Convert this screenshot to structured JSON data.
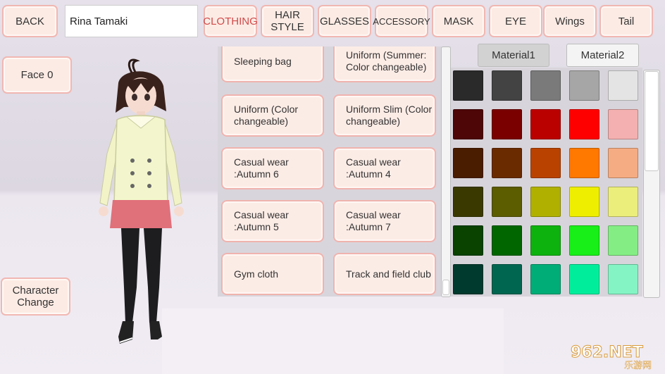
{
  "top": {
    "back_label": "BACK",
    "name_value": "Rina Tamaki",
    "tabs": [
      {
        "label": "CLOTHING",
        "active": true
      },
      {
        "label": "HAIR\nSTYLE"
      },
      {
        "label": "GLASSES"
      },
      {
        "label": "ACCESSORY"
      },
      {
        "label": "MASK"
      },
      {
        "label": "EYE"
      },
      {
        "label": "Wings"
      },
      {
        "label": "Tail"
      }
    ]
  },
  "left": {
    "face_label": "Face",
    "face_value": "0",
    "character_change_label": "Character\nChange"
  },
  "clothing_list": [
    "Sleeping bag",
    "Uniform (Summer:\nColor changeable)",
    "Uniform (Color\nchangeable)",
    "Uniform Slim (Color\nchangeable)",
    "Casual wear\n:Autumn 6",
    "Casual wear\n:Autumn 4",
    "Casual wear\n:Autumn 5",
    "Casual wear\n:Autumn 7",
    "Gym cloth",
    "Track and field club"
  ],
  "material_tabs": [
    "Material1",
    "Material2"
  ],
  "palette": [
    [
      "#2a2a2a",
      "#434343",
      "#7a7a7a",
      "#a6a6a6",
      "#e4e4e4"
    ],
    [
      "#4e0606",
      "#7a0000",
      "#bb0000",
      "#ff0000",
      "#f4b0b0"
    ],
    [
      "#4a1d00",
      "#6b2b00",
      "#ba4200",
      "#ff7800",
      "#f6ac82"
    ],
    [
      "#3a3a00",
      "#5c5c00",
      "#b0b000",
      "#eeee00",
      "#ecee7c"
    ],
    [
      "#0a4200",
      "#026600",
      "#0eb20e",
      "#18ee18",
      "#84ee84"
    ],
    [
      "#003a2e",
      "#006650",
      "#00ad76",
      "#00ee9c",
      "#84f4c4"
    ]
  ],
  "watermark": {
    "brand": "962.NET",
    "sub": "乐游网"
  },
  "colors": {
    "accent_border": "#f1b7b2",
    "button_bg": "#fcebe4",
    "active_tab_text": "#d04a4a"
  }
}
